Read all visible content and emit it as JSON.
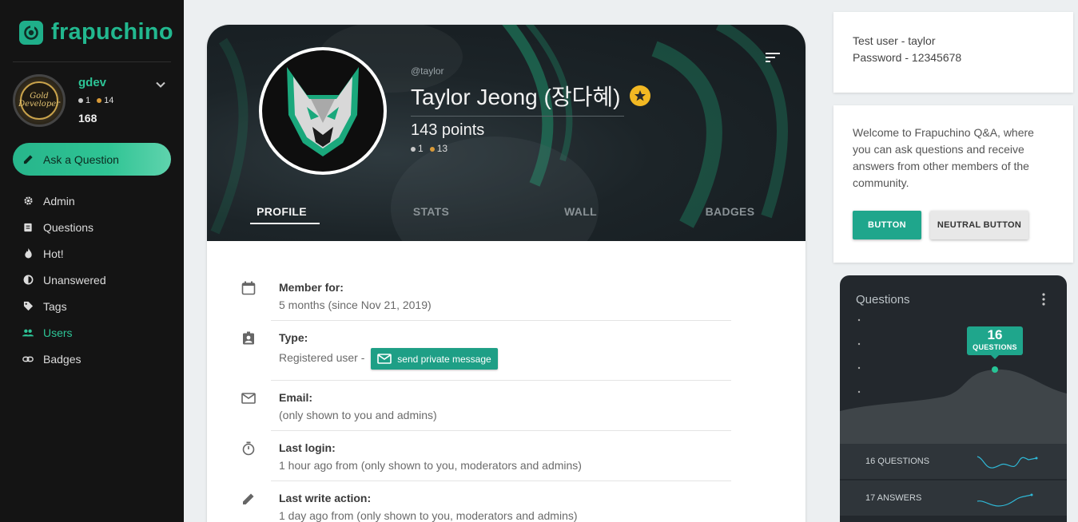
{
  "app": {
    "name": "frapuchino"
  },
  "user": {
    "name": "gdev",
    "silver": "1",
    "bronze": "14",
    "points": "168",
    "avatar_text": "Gold Developer"
  },
  "sidebar": {
    "ask_label": "Ask a Question",
    "items": [
      {
        "label": "Admin",
        "icon": "gear-icon"
      },
      {
        "label": "Questions",
        "icon": "clipboard-icon"
      },
      {
        "label": "Hot!",
        "icon": "fire-icon"
      },
      {
        "label": "Unanswered",
        "icon": "half-circle-icon"
      },
      {
        "label": "Tags",
        "icon": "tag-icon"
      },
      {
        "label": "Users",
        "icon": "users-icon",
        "active": true
      },
      {
        "label": "Badges",
        "icon": "link-icon"
      }
    ]
  },
  "profile": {
    "handle": "@taylor",
    "display_name": "Taylor Jeong (장다혜)",
    "points": "143 points",
    "silver": "1",
    "bronze": "13",
    "tabs": [
      "PROFILE",
      "STATS",
      "WALL",
      "BADGES"
    ],
    "active_tab": "PROFILE",
    "details": [
      {
        "label": "Member for:",
        "value": "5 months (since Nov 21, 2019)",
        "icon": "calendar-icon"
      },
      {
        "label": "Type:",
        "value": "Registered user -",
        "icon": "badge-icon",
        "action": "send private message"
      },
      {
        "label": "Email:",
        "value": "(only shown to you and admins)",
        "icon": "mail-icon"
      },
      {
        "label": "Last login:",
        "value": "1 hour ago from (only shown to you, moderators and admins)",
        "icon": "timer-icon"
      },
      {
        "label": "Last write action:",
        "value": "1 day ago from (only shown to you, moderators and admins)",
        "icon": "pencil-icon"
      }
    ]
  },
  "test_info": {
    "line1": "Test user - taylor",
    "line2": "Password - 12345678"
  },
  "welcome": {
    "text": "Welcome to Frapuchino Q&A, where you can ask questions and receive answers from other members of the community.",
    "button": "BUTTON",
    "neutral_button": "NEUTRAL BUTTON"
  },
  "stats": {
    "title": "Questions",
    "tooltip_value": "16",
    "tooltip_label": "QUESTIONS",
    "rows": [
      "16 QUESTIONS",
      "17 ANSWERS"
    ]
  },
  "colors": {
    "accent": "#1fa68c",
    "brand": "#22b88f",
    "sidebar_bg": "#141414",
    "gold": "#f2b823"
  }
}
